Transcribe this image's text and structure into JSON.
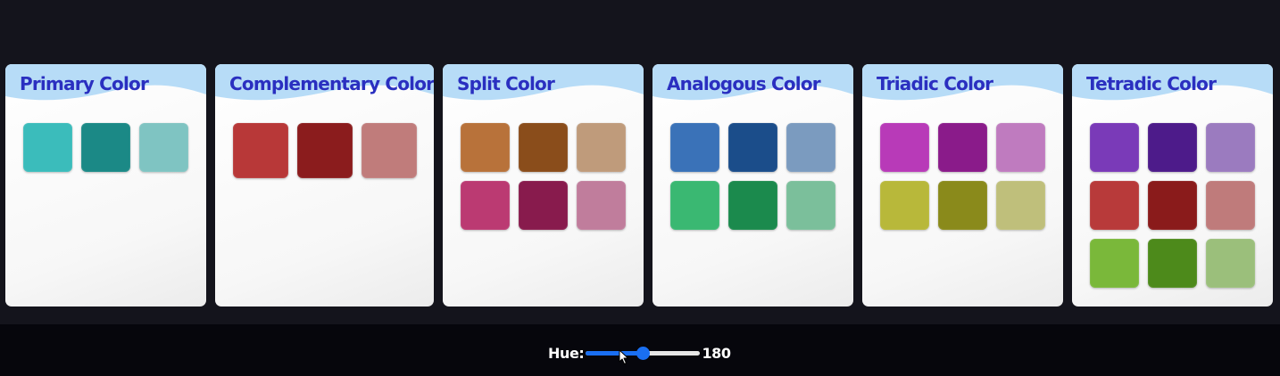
{
  "cards": [
    {
      "title": "Primary Color",
      "swatches": [
        "#3bbcbb",
        "#1b8986",
        "#7fc4c2"
      ]
    },
    {
      "title": "Complementary Color",
      "swatches": [
        "#b83838",
        "#8b1c1d",
        "#c07c7b"
      ]
    },
    {
      "title": "Split Color",
      "swatches": [
        "#b8723a",
        "#8a4d1b",
        "#bf9b7b",
        "#bb3a72",
        "#881b4d",
        "#c07d9c"
      ]
    },
    {
      "title": "Analogous Color",
      "swatches": [
        "#3a72b8",
        "#1b4d8a",
        "#7b9bbf",
        "#3ab872",
        "#1b8a4d",
        "#7bbf9b"
      ]
    },
    {
      "title": "Triadic Color",
      "swatches": [
        "#b83ab8",
        "#8a1b8a",
        "#bf7bbf",
        "#b8b83a",
        "#8a8a1b",
        "#bfbf7b"
      ]
    },
    {
      "title": "Tetradic Color",
      "swatches": [
        "#7a3ab8",
        "#4d1b8a",
        "#9b7bbf",
        "#b83a3a",
        "#8a1b1b",
        "#bf7b7b",
        "#7ab83a",
        "#4d8a1b",
        "#9bbf7b"
      ]
    }
  ],
  "hue": {
    "label": "Hue:",
    "value": "180",
    "fraction": 0.5
  },
  "colors": {
    "title": "#2a2fc0",
    "header_wave": "#b7dcf7",
    "slider_accent": "#1a6ff2"
  }
}
